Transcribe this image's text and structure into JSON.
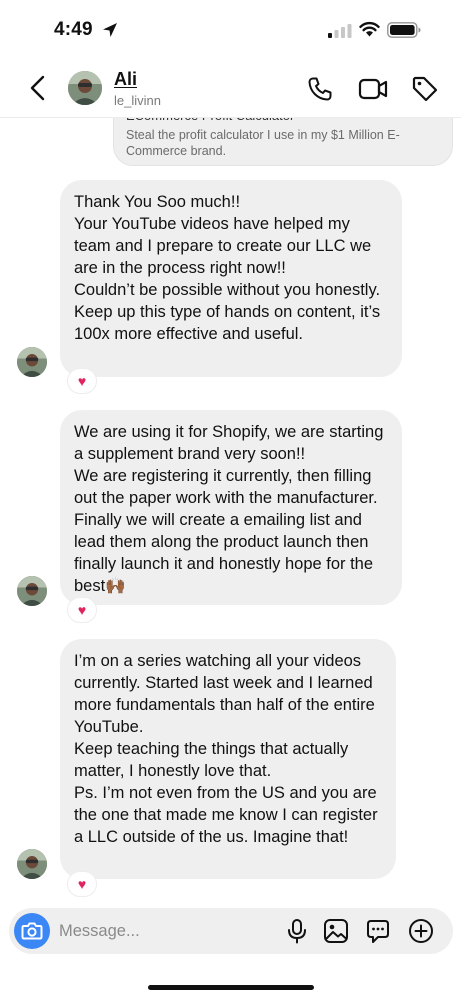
{
  "status_bar": {
    "time": "4:49"
  },
  "header": {
    "contact_name": "Ali",
    "contact_handle": "le_livinn"
  },
  "shared_link": {
    "title": "ECommerce Profit Calculator",
    "description": "Steal the profit calculator I use in my $1 Million E-Commerce brand."
  },
  "messages": [
    {
      "lines": [
        "Thank You Soo much!!",
        "Your YouTube videos have helped my team and I prepare to create our LLC we are in the process right now!!",
        "Couldn’t be possible without you honestly. Keep up this type of hands on content, it’s 100x more effective and useful."
      ],
      "reaction": "♥"
    },
    {
      "lines": [
        "We are using it for Shopify, we are starting a supplement brand very soon!!",
        "We are registering it currently, then filling out the paper work with the manufacturer. Finally we will create a emailing list and lead them along the product launch then finally launch it and honestly hope for the best🙌🏾"
      ],
      "reaction": "♥"
    },
    {
      "lines": [
        "I’m on a series watching all your videos currently. Started last week and I learned more fundamentals than half of the entire YouTube.",
        "Keep teaching the things that actually matter, I honestly love that.",
        "Ps. I’m not even from the US and you are the one that made me know I can register a LLC outside of the us. Imagine that!"
      ],
      "reaction": "♥"
    }
  ],
  "composer": {
    "placeholder": "Message..."
  },
  "colors": {
    "accent": "#3b87f6",
    "bubble": "#efefef",
    "reaction": "#e0245e"
  },
  "icons": [
    "location-arrow-icon",
    "signal-icon",
    "wifi-icon",
    "battery-icon",
    "back-icon",
    "phone-icon",
    "video-icon",
    "tag-icon",
    "camera-icon",
    "mic-icon",
    "gallery-icon",
    "sticker-icon",
    "plus-icon",
    "heart-icon"
  ]
}
